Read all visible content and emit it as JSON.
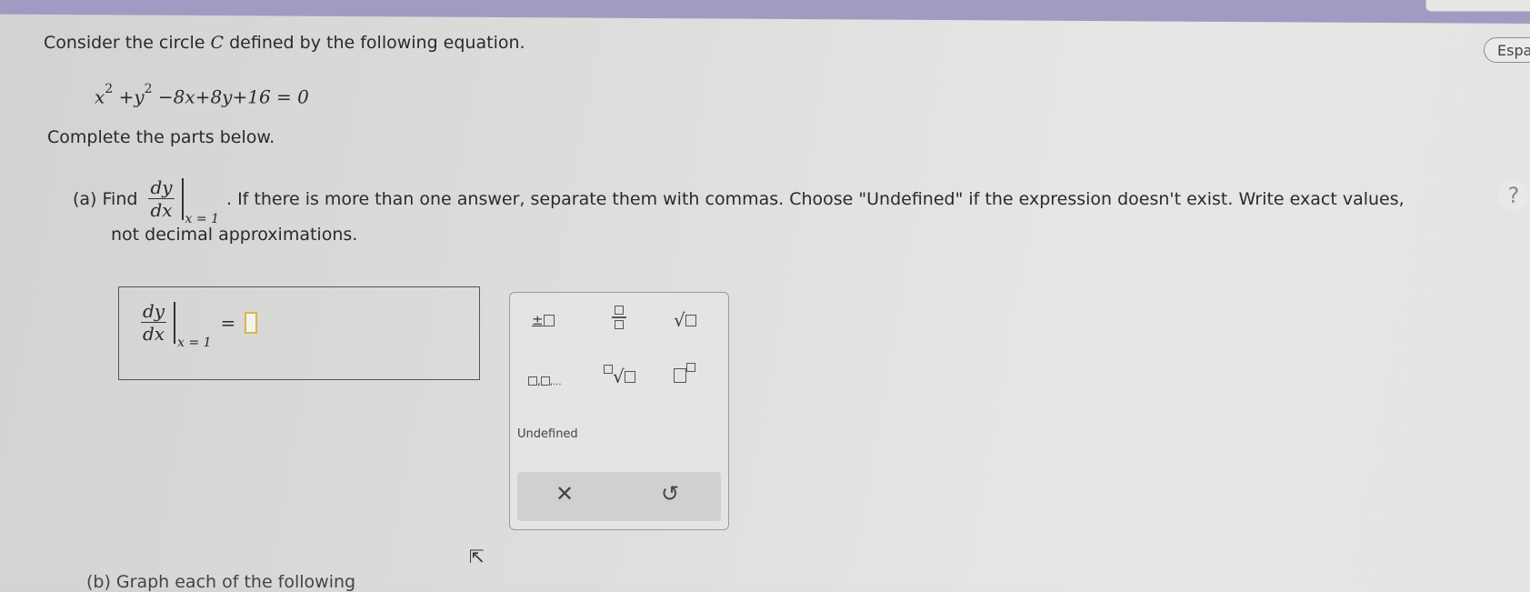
{
  "prompt": "Consider the circle",
  "circle_var": "C",
  "prompt_rest": "defined by the following equation.",
  "equation": {
    "x": "x",
    "y": "y",
    "exp": "2",
    "rest": "−8x+8y+16 = 0"
  },
  "complete": "Complete the parts below.",
  "part_a": {
    "label": "(a) Find",
    "frac_num": "dy",
    "frac_den": "dx",
    "eval_at": "x = 1",
    "instructions_1": ". If there is more than one answer, separate them with commas. Choose \"Undefined\" if the expression doesn't exist. Write exact values,",
    "instructions_2": "not decimal approximations."
  },
  "answer": {
    "frac_num": "dy",
    "frac_den": "dx",
    "eval_at": "x = 1",
    "equals": "=",
    "value": ""
  },
  "keypad": {
    "undefined_label": "Undefined",
    "clear_symbol": "✕",
    "undo_symbol": "↺",
    "sqrt_symbol": "√"
  },
  "part_b": "(b) Graph each of the following",
  "header": {
    "lang_label": "Espa",
    "help_label": "?"
  },
  "colors": {
    "topbar": "#9f9bc2",
    "answer_caret": "#d9b64a"
  }
}
